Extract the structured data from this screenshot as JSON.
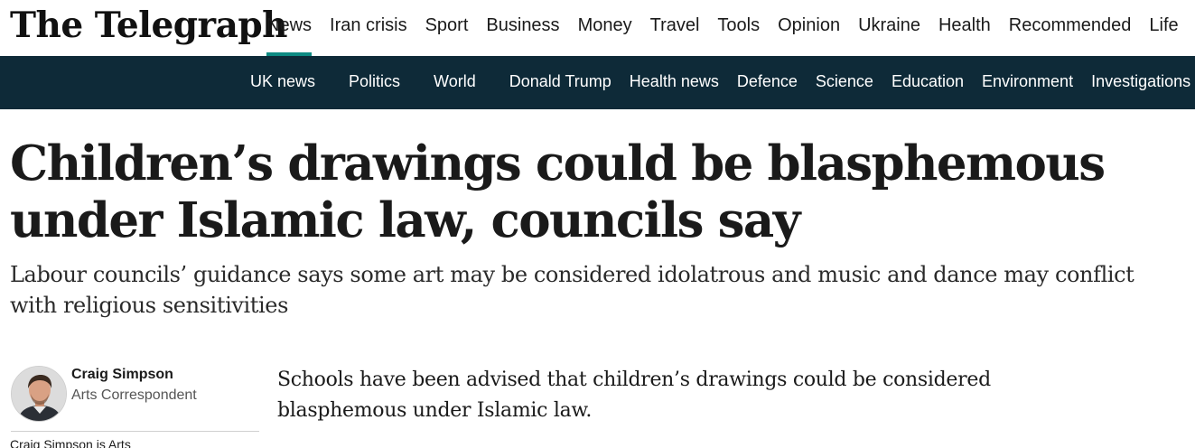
{
  "site": {
    "logo": "The Telegraph"
  },
  "main_nav": {
    "items": [
      {
        "label": "News"
      },
      {
        "label": "Iran crisis"
      },
      {
        "label": "Sport"
      },
      {
        "label": "Business"
      },
      {
        "label": "Money"
      },
      {
        "label": "Travel"
      },
      {
        "label": "Tools"
      },
      {
        "label": "Opinion"
      },
      {
        "label": "Ukraine"
      },
      {
        "label": "Health"
      },
      {
        "label": "Recommended"
      },
      {
        "label": "Life"
      }
    ],
    "active": "News",
    "accent_color": "#0e8b83"
  },
  "sub_nav": {
    "background_color": "#0e2a38",
    "items": [
      {
        "label": "UK news"
      },
      {
        "label": "Politics"
      },
      {
        "label": "World"
      },
      {
        "label": "Donald Trump"
      },
      {
        "label": "Health news"
      },
      {
        "label": "Defence"
      },
      {
        "label": "Science"
      },
      {
        "label": "Education"
      },
      {
        "label": "Environment"
      },
      {
        "label": "Investigations"
      }
    ]
  },
  "article": {
    "headline": "Children’s drawings could be blasphemous under Islamic law, councils say",
    "standfirst": "Labour councils’ guidance says some art may be considered idolatrous and music and dance may conflict with religious sensitivities",
    "author": {
      "name": "Craig Simpson",
      "role": "Arts Correspondent",
      "bio": "Craig Simpson is Arts"
    },
    "body": "Schools have been advised that children’s drawings could be considered blasphemous under Islamic law."
  }
}
